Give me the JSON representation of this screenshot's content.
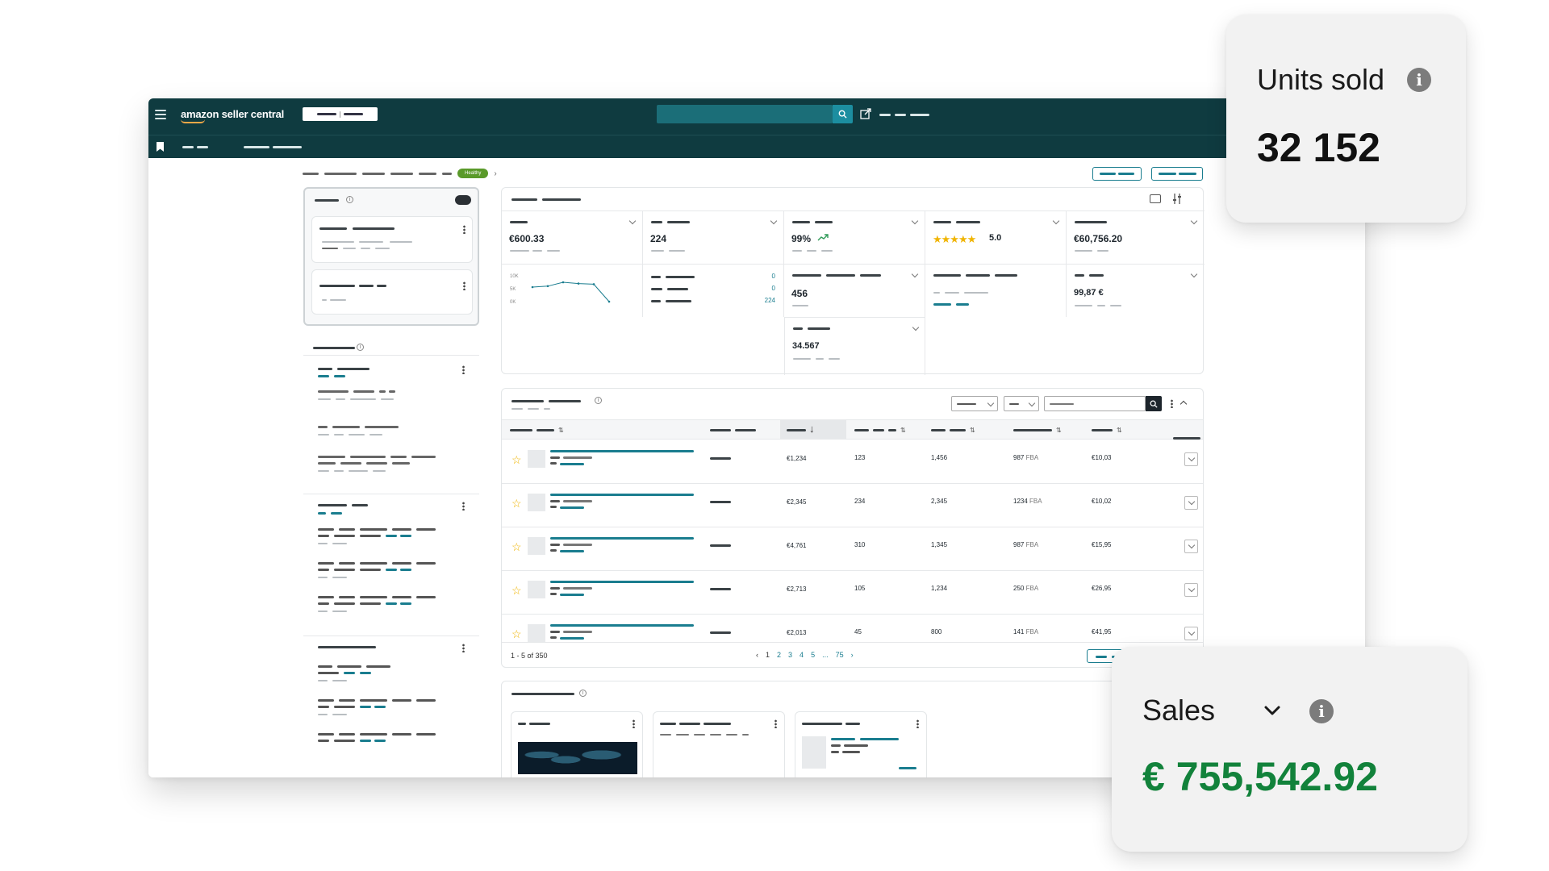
{
  "app": {
    "logo": "amazon seller central"
  },
  "breadcrumb": {
    "health_badge": "Healthy"
  },
  "kpis": {
    "sales": "€600.33",
    "orders": "224",
    "rate": "99%",
    "rating": "5.0",
    "rating_stars": 5,
    "revenue": "€60,756.20",
    "units": "456",
    "avg_price": "99,87 €",
    "views": "34.567",
    "mini_chart_yticks": [
      "10K",
      "5K",
      "0K"
    ],
    "mini_chart_values": [
      0.55,
      0.58,
      0.7,
      0.66,
      0.64,
      0.1
    ],
    "counts": [
      "0",
      "0",
      "224"
    ]
  },
  "table": {
    "rows": [
      {
        "price": "€1,234",
        "qty": "123",
        "sales": "1,456",
        "stock": "987",
        "stock_tag": "FBA",
        "fee": "€10,03"
      },
      {
        "price": "€2,345",
        "qty": "234",
        "sales": "2,345",
        "stock": "1234",
        "stock_tag": "FBA",
        "fee": "€10,02"
      },
      {
        "price": "€4,761",
        "qty": "310",
        "sales": "1,345",
        "stock": "987",
        "stock_tag": "FBA",
        "fee": "€15,95"
      },
      {
        "price": "€2,713",
        "qty": "105",
        "sales": "1,234",
        "stock": "250",
        "stock_tag": "FBA",
        "fee": "€26,95"
      },
      {
        "price": "€2,013",
        "qty": "45",
        "sales": "800",
        "stock": "141",
        "stock_tag": "FBA",
        "fee": "€41,95"
      }
    ],
    "pagination": {
      "range": "1 - 5 of 350",
      "pages": [
        "1",
        "2",
        "3",
        "4",
        "5",
        "...",
        "75"
      ],
      "prev": "‹",
      "next": "›"
    }
  },
  "units_card": {
    "title": "Units sold",
    "value": "32 152",
    "info": "i"
  },
  "sales_card": {
    "title": "Sales",
    "value": "€ 755,542.92",
    "info": "i",
    "value_color": "#12823b"
  },
  "colors": {
    "nav": "#0f3b40",
    "accent": "#1a7d8f",
    "badge": "#5a9a2a",
    "star": "#f0b400"
  }
}
